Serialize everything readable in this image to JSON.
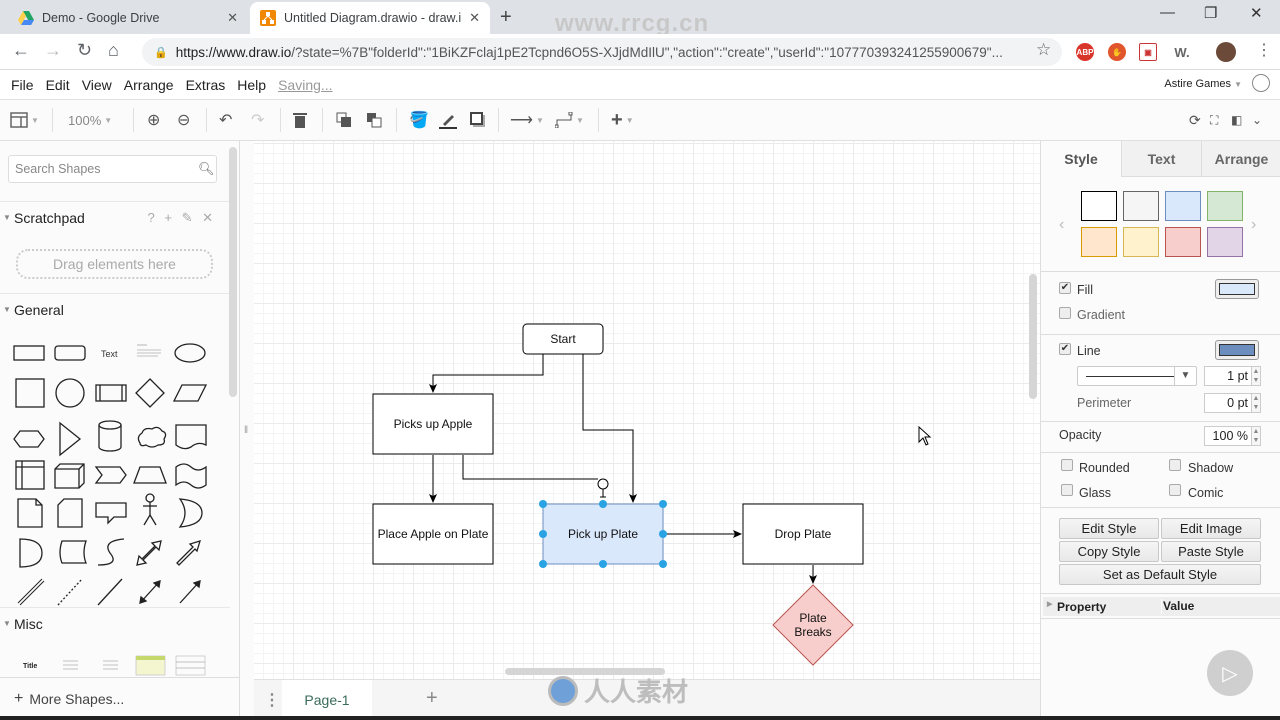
{
  "browser": {
    "tabs": [
      {
        "title": "Demo - Google Drive",
        "icon": "google-drive-icon",
        "active": false
      },
      {
        "title": "Untitled Diagram.drawio - draw.io",
        "icon": "drawio-icon",
        "active": true
      }
    ],
    "url_host": "https://www.draw.io",
    "url_rest": "/?state=%7B\"folderId\":\"1BiKZFclaj1pE2Tcpnd6O5S-XJjdMdIlU\",\"action\":\"create\",\"userId\":\"107770393241255900679\"...",
    "extensions": [
      "ABP",
      "stop",
      "clip",
      "W."
    ]
  },
  "menubar": {
    "items": [
      "File",
      "Edit",
      "View",
      "Arrange",
      "Extras",
      "Help"
    ],
    "status": "Saving...",
    "account": "Astire Games"
  },
  "toolbar": {
    "zoom": "100%"
  },
  "sidebar": {
    "search_placeholder": "Search Shapes",
    "scratchpad": {
      "title": "Scratchpad",
      "tools": "? + ✎ ✕",
      "dropzone": "Drag elements here"
    },
    "general_title": "General",
    "shape_text_label": "Text",
    "misc_title": "Misc",
    "misc_title_label": "Title",
    "more_shapes": "More Shapes..."
  },
  "diagram": {
    "nodes": [
      {
        "id": "start",
        "label": "Start",
        "shape": "rounded"
      },
      {
        "id": "apple",
        "label": "Picks up Apple",
        "shape": "rect"
      },
      {
        "id": "place",
        "label": "Place Apple on Plate",
        "shape": "rect"
      },
      {
        "id": "plate",
        "label": "Pick up Plate",
        "shape": "rect",
        "selected": true
      },
      {
        "id": "drop",
        "label": "Drop Plate",
        "shape": "rect"
      },
      {
        "id": "breaks",
        "label_lines": [
          "Plate",
          "Breaks"
        ],
        "shape": "diamond"
      }
    ],
    "edges": [
      [
        "start",
        "apple"
      ],
      [
        "start",
        "plate"
      ],
      [
        "apple",
        "place"
      ],
      [
        "apple",
        "plate"
      ],
      [
        "plate",
        "drop"
      ],
      [
        "drop",
        "breaks"
      ]
    ],
    "colors": {
      "selected_fill": "#dae8fc",
      "selected_stroke": "#6c8ebf",
      "handle": "#29a3e3",
      "diamond_fill": "#f8cecc",
      "diamond_stroke": "#b85450"
    }
  },
  "pages": {
    "current": "Page-1"
  },
  "format_panel": {
    "tabs": [
      "Style",
      "Text",
      "Arrange"
    ],
    "swatches": [
      "#ffffff",
      "#f5f5f5",
      "#dae8fc",
      "#d5e8d4",
      "#ffe6cc",
      "#fff2cc",
      "#f8cecc",
      "#e1d5e7"
    ],
    "fill": {
      "label": "Fill",
      "checked": true,
      "color": "#dae8fc"
    },
    "gradient": {
      "label": "Gradient",
      "checked": false
    },
    "line": {
      "label": "Line",
      "checked": true,
      "color": "#6c8ebf",
      "width": "1 pt"
    },
    "perimeter": {
      "label": "Perimeter",
      "value": "0 pt"
    },
    "opacity": {
      "label": "Opacity",
      "value": "100 %"
    },
    "options": [
      {
        "label": "Rounded",
        "checked": false
      },
      {
        "label": "Shadow",
        "checked": false
      },
      {
        "label": "Glass",
        "checked": false
      },
      {
        "label": "Comic",
        "checked": false
      }
    ],
    "buttons": {
      "edit_style": "Edit Style",
      "edit_image": "Edit Image",
      "copy_style": "Copy Style",
      "paste_style": "Paste Style",
      "set_default": "Set as Default Style"
    },
    "property_header": {
      "property": "Property",
      "value": "Value"
    }
  },
  "watermarks": {
    "top": "www.rrcg.cn",
    "bottom": "人人素材"
  }
}
